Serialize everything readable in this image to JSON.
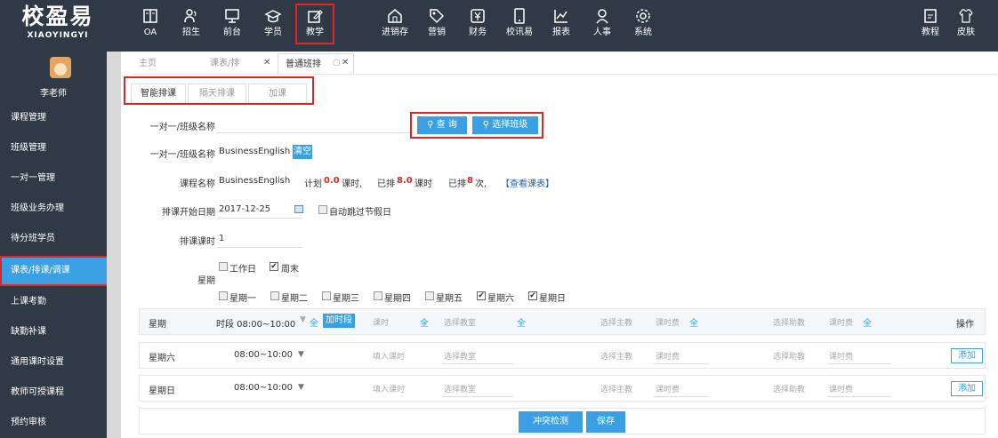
{
  "logo": {
    "cn": "校盈易",
    "en": "XIAOYINGYI"
  },
  "nav": [
    {
      "label": "OA",
      "icon": "book-icon"
    },
    {
      "label": "招生",
      "icon": "people-icon"
    },
    {
      "label": "前台",
      "icon": "monitor-icon"
    },
    {
      "label": "学员",
      "icon": "graduation-cap-icon"
    },
    {
      "label": "教学",
      "icon": "edit-icon"
    },
    {
      "label": "进销存",
      "icon": "house-icon"
    },
    {
      "label": "营销",
      "icon": "tag-icon"
    },
    {
      "label": "财务",
      "icon": "yen-icon"
    },
    {
      "label": "校讯易",
      "icon": "phone-icon"
    },
    {
      "label": "报表",
      "icon": "line-chart-icon"
    },
    {
      "label": "人事",
      "icon": "person-icon"
    },
    {
      "label": "系统",
      "icon": "gear-icon"
    }
  ],
  "nav_right": [
    {
      "label": "教程",
      "icon": "document-icon"
    },
    {
      "label": "皮肤",
      "icon": "shirt-icon"
    }
  ],
  "sidebar": {
    "user": "李老师",
    "items": [
      "课程管理",
      "班级管理",
      "一对一管理",
      "班级业务办理",
      "待分班学员",
      "课表/排课/调课",
      "上课考勤",
      "缺勤补课",
      "通用课时设置",
      "教师可授课程",
      "预约审核"
    ]
  },
  "page_tabs": [
    "主页",
    "课表/排",
    "普通班排"
  ],
  "sub_tabs": [
    "智能排课",
    "隔天排课",
    "加课"
  ],
  "form": {
    "class_label": "一对一/班级名称",
    "query_btn": "查 询",
    "select_class_btn": "选择班级",
    "class_label2": "一对一/班级名称",
    "class_value": "BusinessEnglish",
    "clear_btn": "清空",
    "course_label": "课程名称",
    "course_value": "BusinessEnglish",
    "plan_prefix": "计划",
    "plan_hours": "0.0",
    "plan_unit": "课时,",
    "scheduled_prefix": "已排",
    "scheduled_hours": "8.0",
    "scheduled_unit": "课时",
    "count_prefix": "已排",
    "count_value": "8",
    "count_unit": "次,",
    "view_schedule": "【查看课表】",
    "start_date_label": "排课开始日期",
    "start_date": "2017-12-25",
    "skip_holidays": "自动跳过节假日",
    "hours_label": "排课课时",
    "hours_value": "1",
    "week_label": "星期",
    "workday": "工作日",
    "weekend": "周末",
    "weekdays": [
      "星期一",
      "星期二",
      "星期三",
      "星期四",
      "星期五",
      "星期六",
      "星期日"
    ],
    "weekdays_checked": [
      false,
      false,
      false,
      false,
      false,
      true,
      true
    ]
  },
  "table": {
    "h_week": "星期",
    "h_period": "时段 08:00~10:00",
    "all": "全",
    "add_period_btn": "加时段",
    "h_hours": "课时",
    "h_room": "选择教室",
    "h_teacher": "选择主教",
    "h_fee": "课时费",
    "h_assistant": "选择助教",
    "h_fee2": "课时费",
    "h_action": "操作",
    "rows": [
      {
        "day": "星期六",
        "time": "08:00~10:00",
        "hours_ph": "填入课时",
        "room_ph": "选择教室",
        "teacher_ph": "选择主教",
        "fee_ph": "课时费",
        "assistant_ph": "选择助教",
        "fee2_ph": "课时费",
        "add": "添加"
      },
      {
        "day": "星期日",
        "time": "08:00~10:00",
        "hours_ph": "填入课时",
        "room_ph": "选择教室",
        "teacher_ph": "选择主教",
        "fee_ph": "课时费",
        "assistant_ph": "选择助教",
        "fee2_ph": "课时费",
        "add": "添加"
      }
    ],
    "conflict_btn": "冲突检测",
    "save_btn": "保存"
  },
  "colors": {
    "sidebar": "#2f3a46",
    "accent": "#3aa0e3",
    "highlight": "#e02525"
  }
}
